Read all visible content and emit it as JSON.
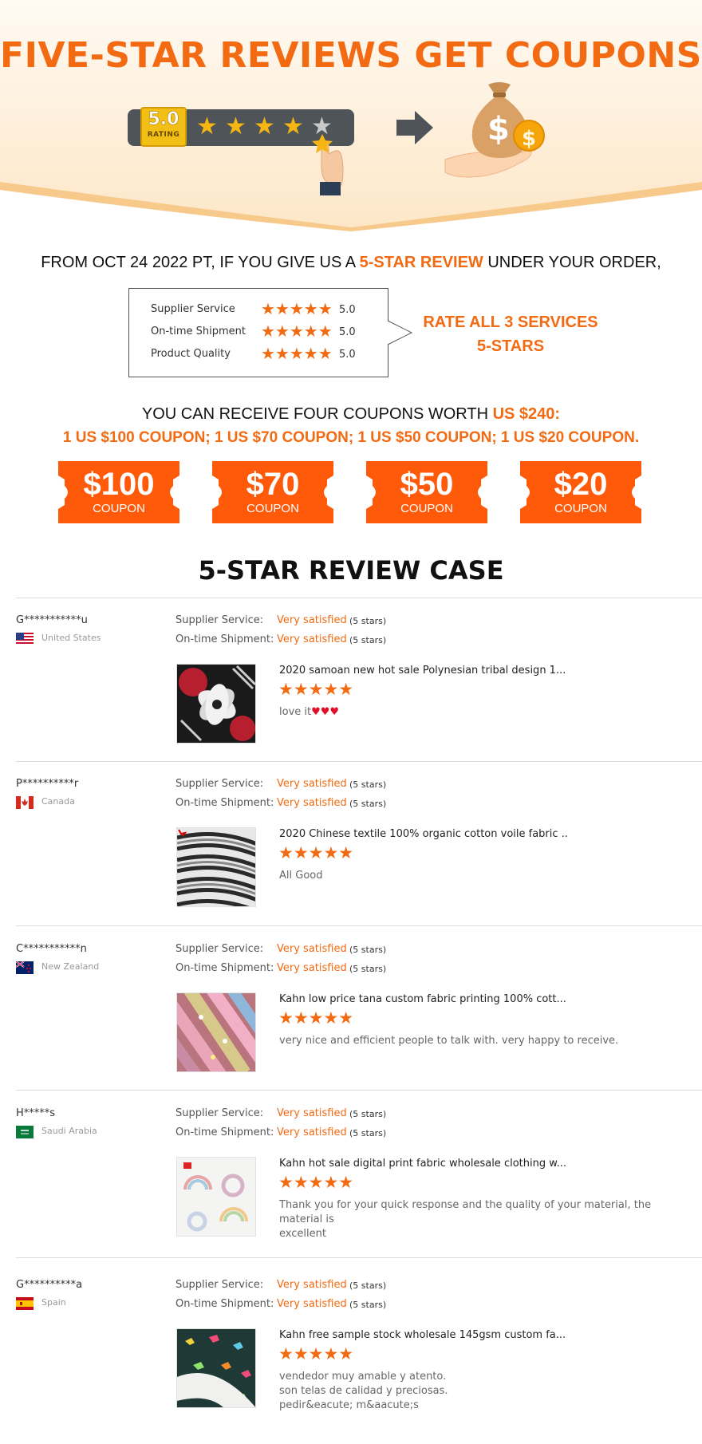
{
  "banner": {
    "title": "FIVE-STAR REVIEWS GET COUPONS",
    "rating_value": "5.0",
    "rating_word": "RATING"
  },
  "intro": {
    "prefix": "FROM OCT 24 2022 PT, IF YOU GIVE US A ",
    "highlight": "5-STAR REVIEW",
    "suffix": " UNDER YOUR ORDER,"
  },
  "services": [
    {
      "label": "Supplier Service",
      "stars": "★★★★★",
      "score": "5.0"
    },
    {
      "label": "On-time Shipment",
      "stars": "★★★★★",
      "score": "5.0"
    },
    {
      "label": "Product Quality",
      "stars": "★★★★★",
      "score": "5.0"
    }
  ],
  "rate_all": {
    "line1": "RATE ALL 3 SERVICES",
    "line2": "5-STARS"
  },
  "receive": {
    "prefix": "YOU CAN RECEIVE FOUR COUPONS WORTH ",
    "amount": "US $240:",
    "breakdown": "1 US $100 COUPON; 1 US $70 COUPON; 1 US $50 COUPON; 1 US $20 COUPON."
  },
  "coupons": [
    {
      "amount": "$100",
      "word": "COUPON"
    },
    {
      "amount": "$70",
      "word": "COUPON"
    },
    {
      "amount": "$50",
      "word": "COUPON"
    },
    {
      "amount": "$20",
      "word": "COUPON"
    }
  ],
  "case_title": "5-STAR REVIEW CASE",
  "labels": {
    "supplier_service": "Supplier Service:",
    "on_time_shipment": "On-time Shipment:",
    "very_satisfied": "Very satisfied",
    "five_stars": "(5 stars)"
  },
  "reviews": [
    {
      "reviewer": "G***********u",
      "country": "United States",
      "product": "2020 samoan new hot sale Polynesian tribal design 1...",
      "stars": "★★★★★",
      "text": "love it",
      "hearts": "♥♥♥"
    },
    {
      "reviewer": "P**********r",
      "country": "Canada",
      "product": "2020 Chinese textile 100% organic cotton voile fabric ..",
      "stars": "★★★★★",
      "text": "All Good",
      "hearts": ""
    },
    {
      "reviewer": "C***********n",
      "country": "New Zealand",
      "product": "Kahn low price tana custom fabric printing 100% cott...",
      "stars": "★★★★★",
      "text": "very nice and efficient people to talk with. very happy to receive.",
      "hearts": ""
    },
    {
      "reviewer": "H*****s",
      "country": "Saudi Arabia",
      "product": "Kahn hot sale digital print fabric wholesale clothing w...",
      "stars": "★★★★★",
      "text": "Thank you for your quick response and the quality of your material, the material is\nexcellent",
      "hearts": ""
    },
    {
      "reviewer": "G**********a",
      "country": "Spain",
      "product": "Kahn free sample stock wholesale 145gsm custom fa...",
      "stars": "★★★★★",
      "text": "vendedor muy amable y atento.\nson telas de calidad y preciosas.\npedir&eacute; m&aacute;s",
      "hearts": ""
    }
  ],
  "colors": {
    "accent": "#f26a12",
    "coupon": "#ff5a0a",
    "rating_bar": "#4e5457",
    "badge": "#f2bf17"
  }
}
